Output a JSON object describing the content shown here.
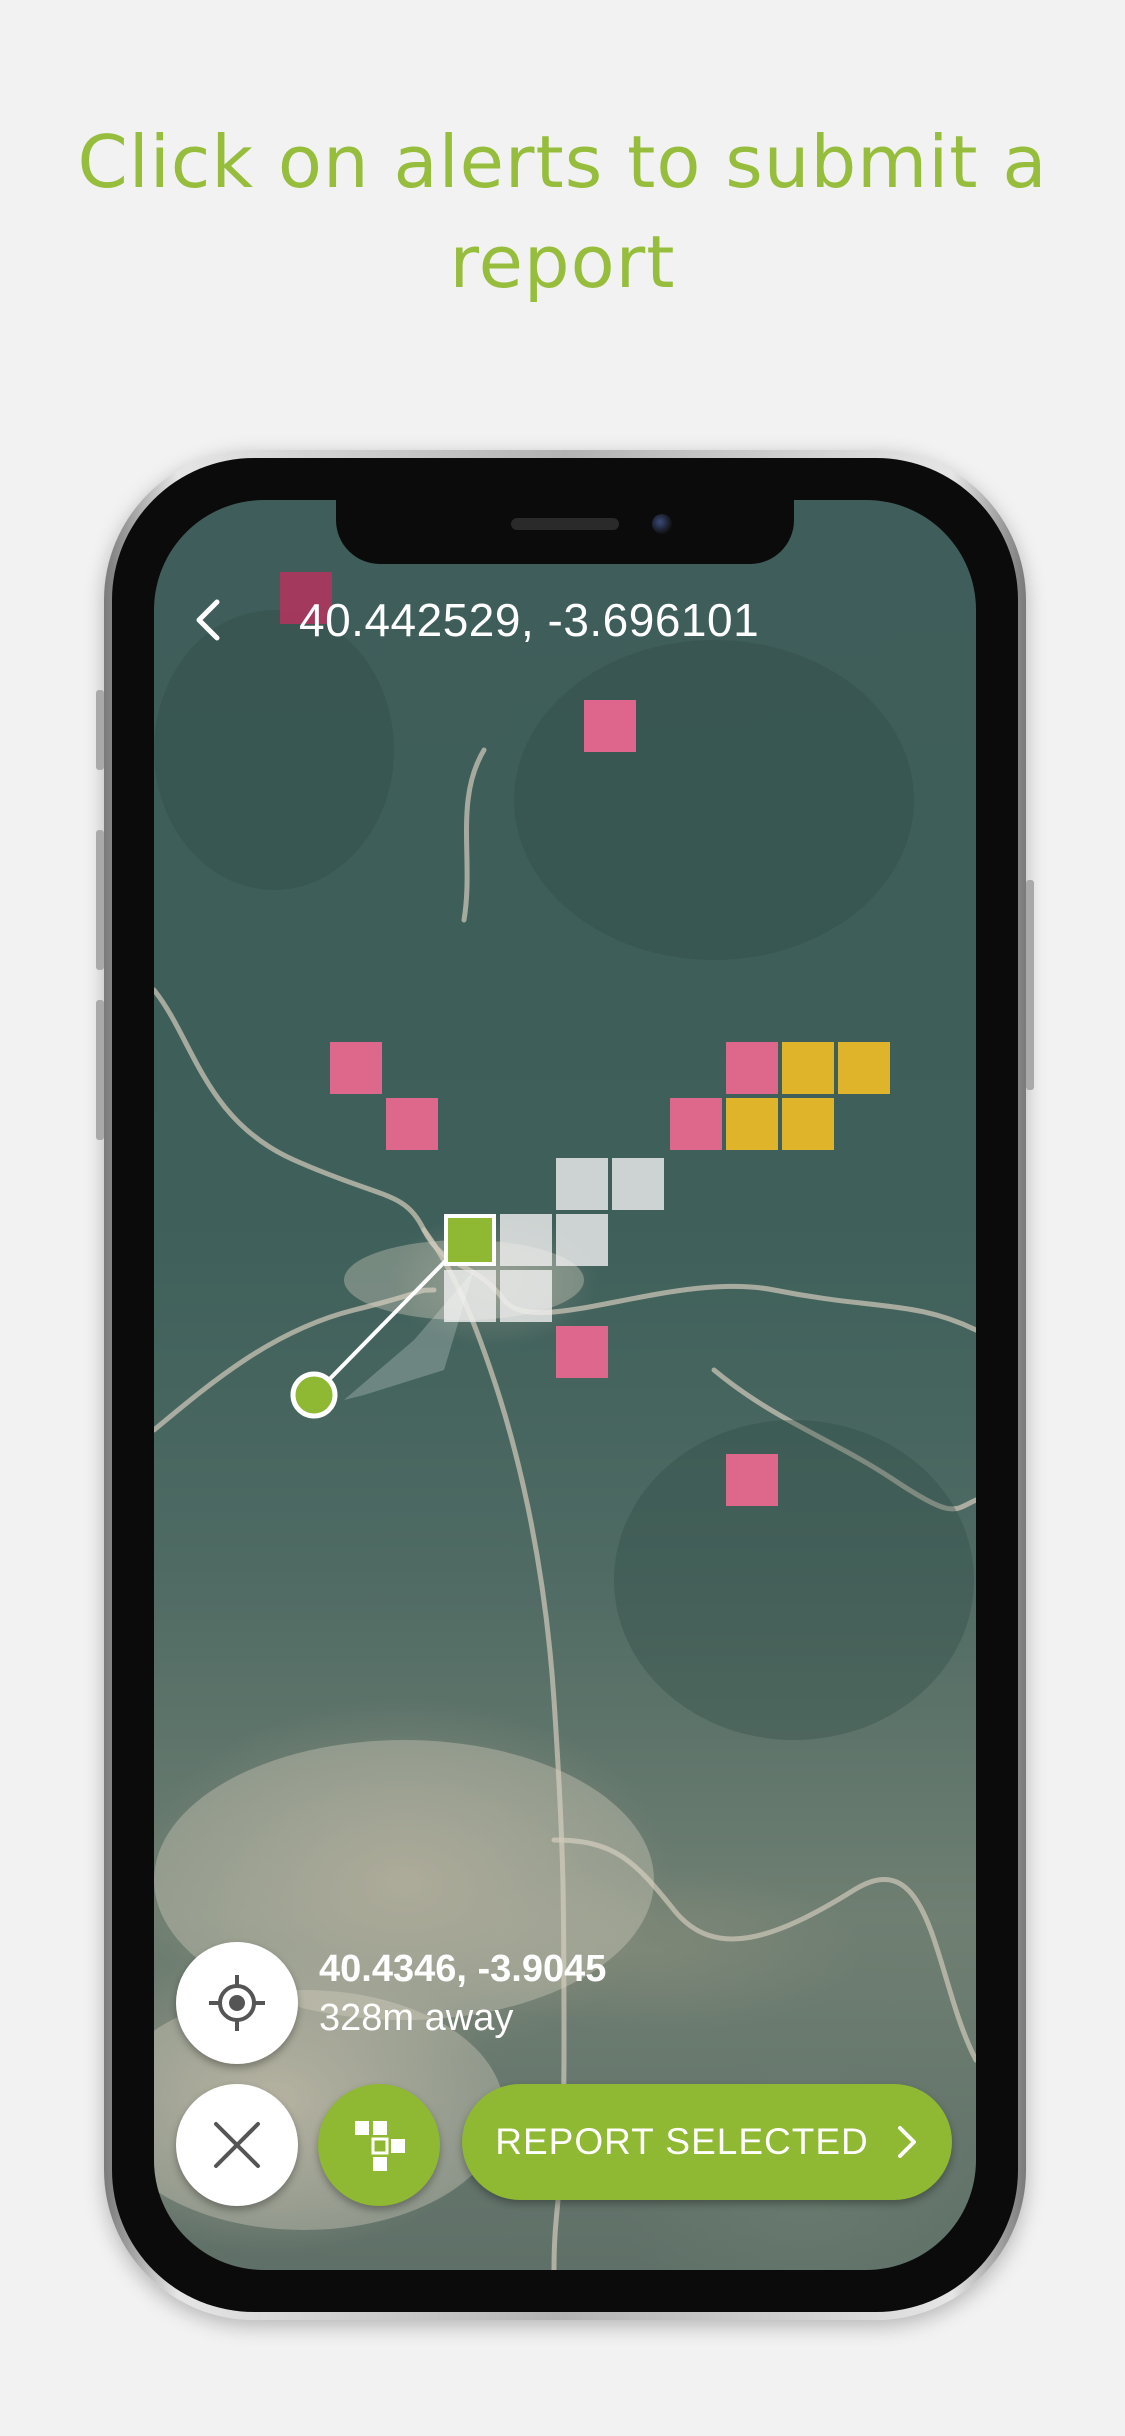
{
  "promo": {
    "headline": "Click on alerts to submit a report"
  },
  "map_screen": {
    "header": {
      "coordinates": "40.442529, -3.696101",
      "back_icon": "chevron-left-icon"
    },
    "selection_info": {
      "coordinates": "40.4346, -3.9045",
      "distance": "328m away"
    },
    "buttons": {
      "locate_icon": "crosshair-icon",
      "close_icon": "close-icon",
      "area_icon": "grid-select-icon",
      "report_label": "REPORT SELECTED",
      "report_icon": "chevron-right-icon"
    },
    "colors": {
      "accent": "#8fb833",
      "headline": "#97bd3d",
      "alert_pink": "#e7678f",
      "alert_yellow": "#e0b42a",
      "selected_cell": "#8fb833"
    }
  }
}
